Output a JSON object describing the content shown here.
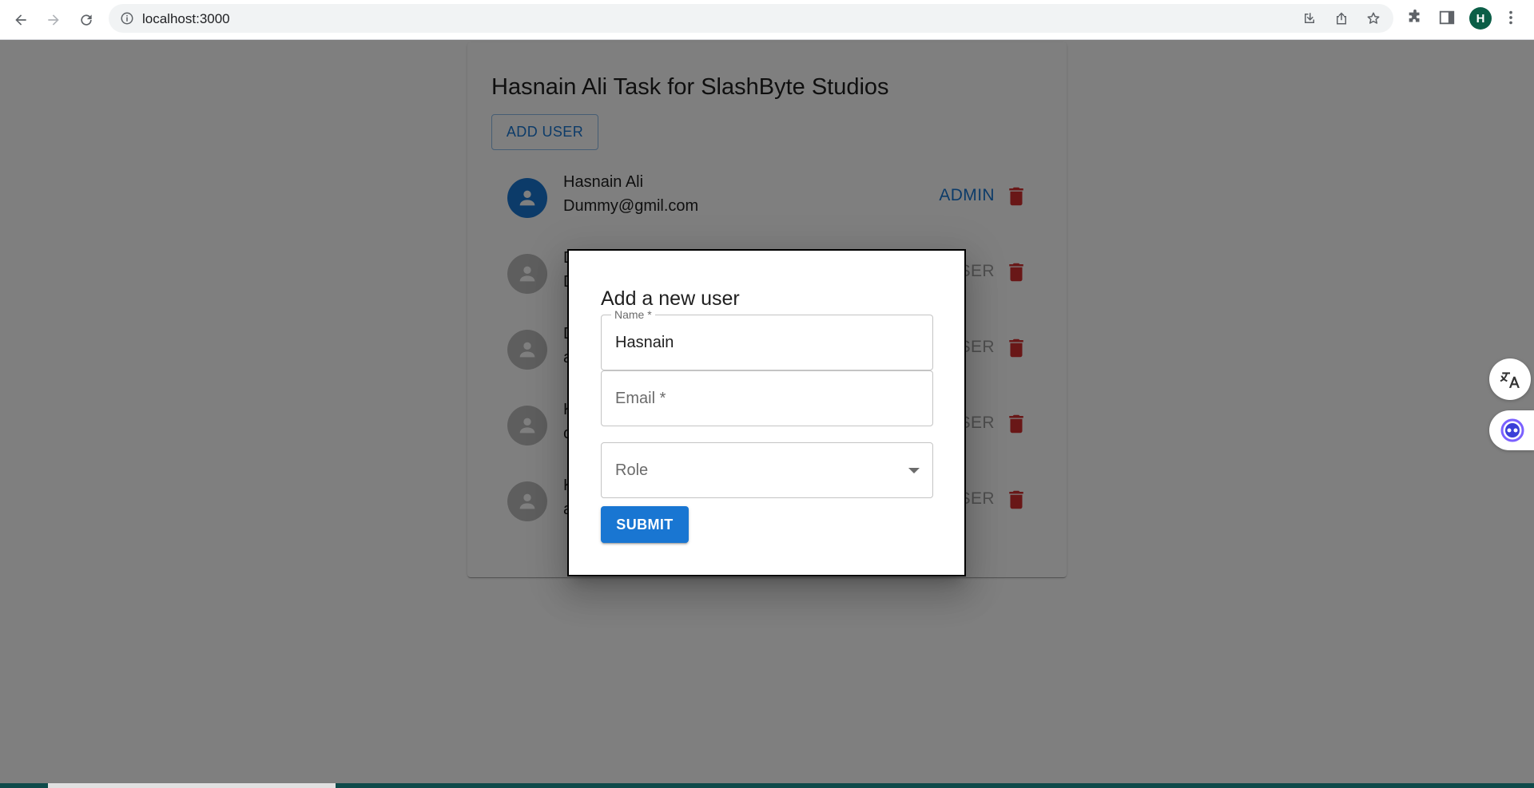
{
  "browser": {
    "url": "localhost:3000",
    "profile_initial": "H"
  },
  "page": {
    "title": "Hasnain Ali Task for SlashByte Studios",
    "add_user_label": "ADD USER",
    "users": [
      {
        "name": "Hasnain Ali",
        "email": "Dummy@gmil.com",
        "role": "ADMIN",
        "avatar_color": "#1976d2"
      },
      {
        "name": "D",
        "email": "D",
        "role": "SER",
        "avatar_color": "#bdbdbd"
      },
      {
        "name": "D",
        "email": "a",
        "role": "SER",
        "avatar_color": "#bdbdbd"
      },
      {
        "name": "K",
        "email": "c",
        "role": "SER",
        "avatar_color": "#bdbdbd"
      },
      {
        "name": "K",
        "email": "a",
        "role": "SER",
        "avatar_color": "#bdbdbd"
      }
    ]
  },
  "modal": {
    "title": "Add a new user",
    "name_label": "Name *",
    "name_value": "Hasnain",
    "email_placeholder": "Email *",
    "role_placeholder": "Role",
    "submit_label": "SUBMIT"
  },
  "colors": {
    "primary": "#1976d2",
    "delete": "#d32f2f",
    "backdrop": "rgba(0,0,0,0.5)"
  }
}
